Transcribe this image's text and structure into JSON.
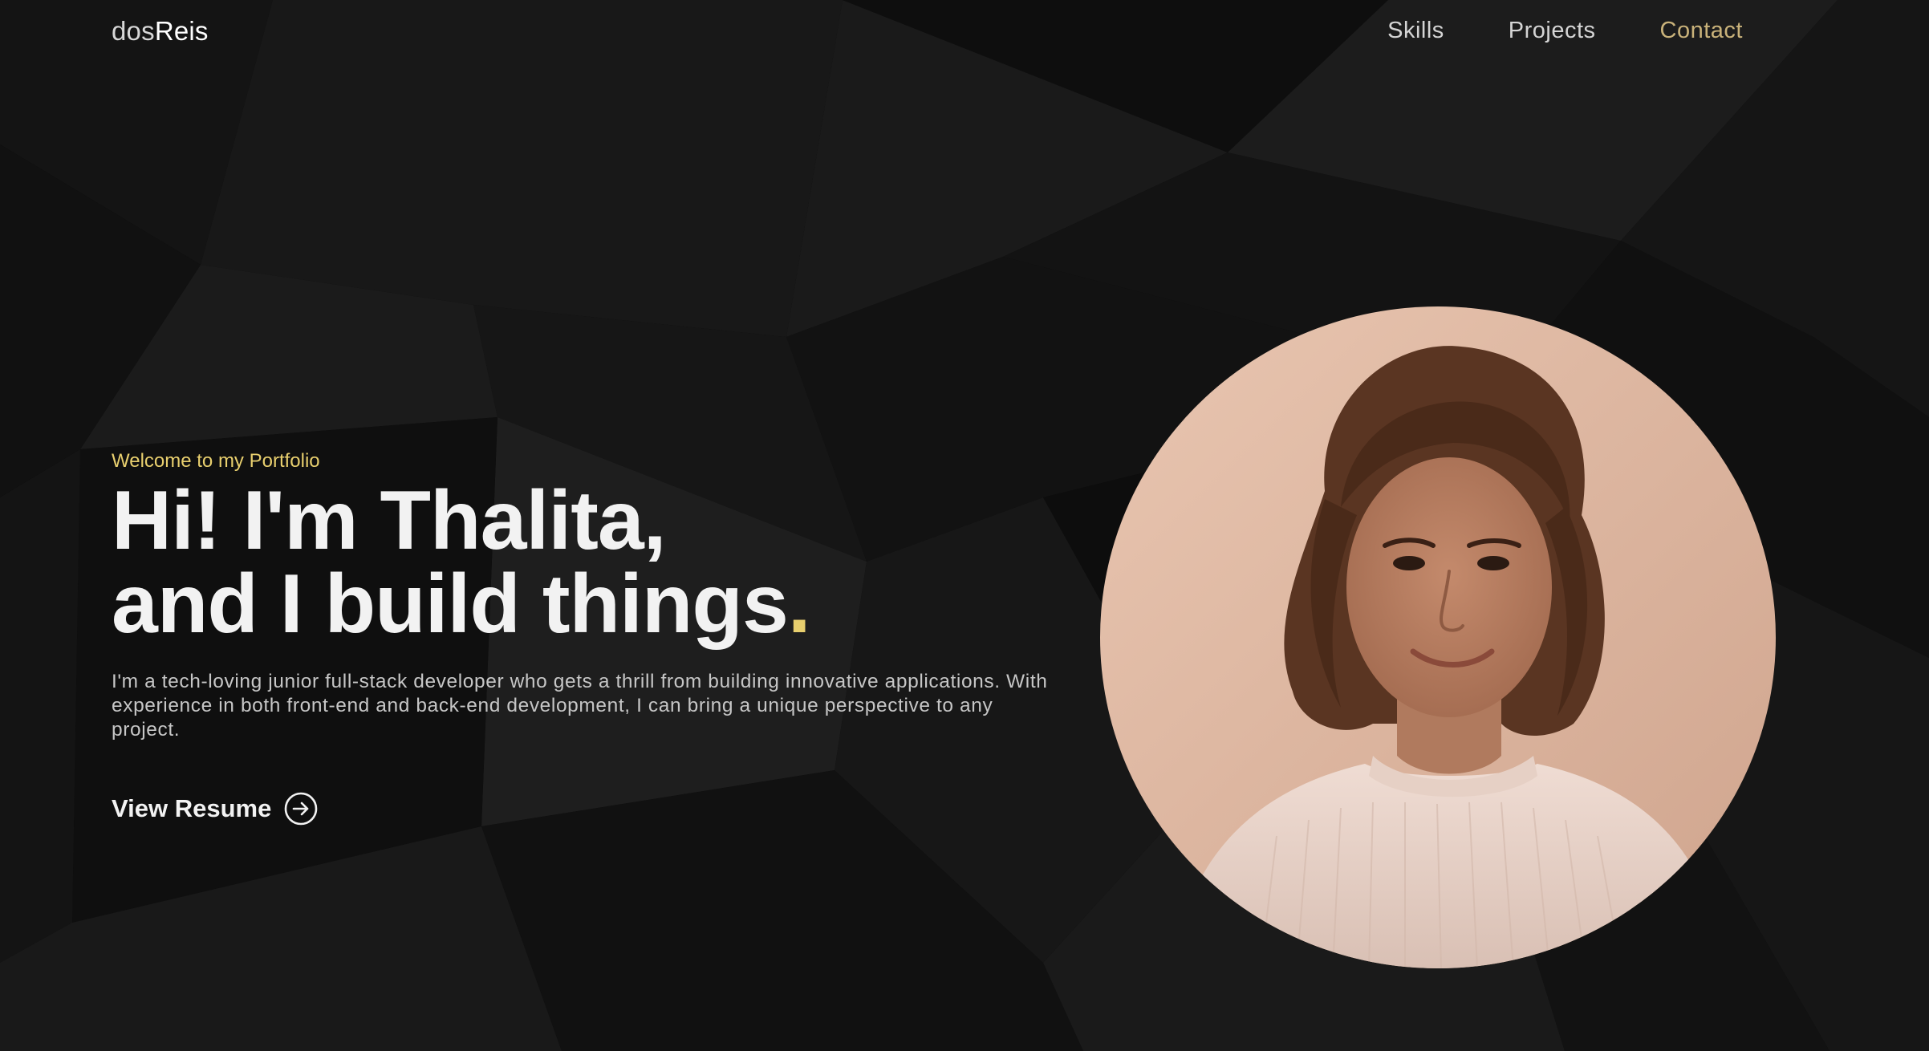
{
  "header": {
    "logo_light": "dos",
    "logo_bold": "Reis",
    "nav": [
      {
        "label": "Skills"
      },
      {
        "label": "Projects"
      },
      {
        "label": "Contact"
      }
    ]
  },
  "hero": {
    "welcome": "Welcome to my Portfolio",
    "headline_line1": "Hi! I'm Thalita,",
    "headline_line2": "and I build things",
    "headline_dot": ".",
    "intro": "I'm a tech-loving junior full-stack developer who gets a thrill from building innovative applications. With experience in both front-end and back-end development, I can bring a unique perspective to any project.",
    "cta_label": "View Resume",
    "cta_icon": "arrow-right-circle-icon"
  },
  "portrait": {
    "icon": "profile-photo"
  },
  "colors": {
    "background": "#0b0b0b",
    "accent_yellow": "#e8cf6e",
    "nav_accent": "#c9b27a",
    "text_primary": "#f2f2f2",
    "text_secondary": "#c6c6c6"
  }
}
